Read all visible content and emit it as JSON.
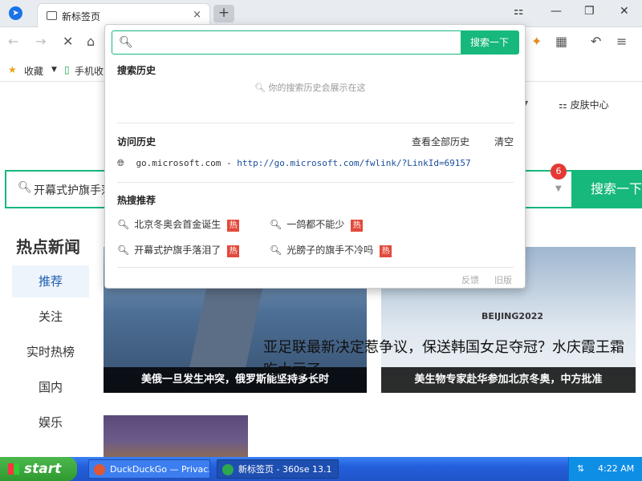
{
  "browser": {
    "tab_title": "新标签页",
    "tab_close": "×",
    "new_tab": "+",
    "window_controls": [
      "⚏",
      "—",
      "❐",
      "✕"
    ]
  },
  "toolbar": {
    "back": "←",
    "forward": "→",
    "stop": "✕",
    "home": "⌂",
    "undo": "↶",
    "menu": "≡"
  },
  "bookmarks": [
    {
      "label": "收藏",
      "icon": "star-icon"
    },
    {
      "label": "手机收",
      "icon": "phone-icon"
    }
  ],
  "dropdown": {
    "input_value": "",
    "search_button": "搜索一下",
    "history_title": "搜索历史",
    "history_empty": "你的搜索历史会展示在这",
    "visit_title": "访问历史",
    "view_all": "查看全部历史",
    "clear": "清空",
    "visit_item_site": "go.microsoft.com",
    "visit_item_dash": " - ",
    "visit_item_url": "http://go.microsoft.com/fwlink/?LinkId=69157",
    "hot_title": "热搜推荐",
    "hot_items": [
      {
        "text": "北京冬奥会首金诞生",
        "tag": "热"
      },
      {
        "text": "一鸽都不能少",
        "tag": "热"
      },
      {
        "text": "开幕式护旗手落泪了",
        "tag": "热"
      },
      {
        "text": "光膀子的旗手不冷吗",
        "tag": "热"
      }
    ],
    "feedback": "反馈",
    "old_version": "旧版"
  },
  "page": {
    "skin_center": "皮肤中心",
    "search_text": "开幕式护旗手落",
    "badge_count": "6",
    "search_button": "搜索一下",
    "news_title": "热点新闻",
    "nav": [
      "推荐",
      "关注",
      "实时热榜",
      "国内",
      "娱乐"
    ],
    "cards": [
      {
        "caption": "美俄一旦发生冲突，俄罗斯能坚持多长时"
      },
      {
        "caption": "美生物专家赴华参加北京冬奥，中方批准"
      }
    ],
    "beijing_logo": "BEIJING2022",
    "headline": "亚足联最新决定惹争议，保送韩国女足夺冠？水庆霞王霜吃大亏了"
  },
  "taskbar": {
    "start": "start",
    "tasks": [
      {
        "label": "DuckDuckGo — Privac..."
      },
      {
        "label": "新标签页 - 360se 13.1"
      }
    ],
    "time": "4:22 AM"
  },
  "colors": {
    "accent": "#17b87c",
    "hot_tag": "#e24a3b",
    "badge": "#e53935"
  }
}
